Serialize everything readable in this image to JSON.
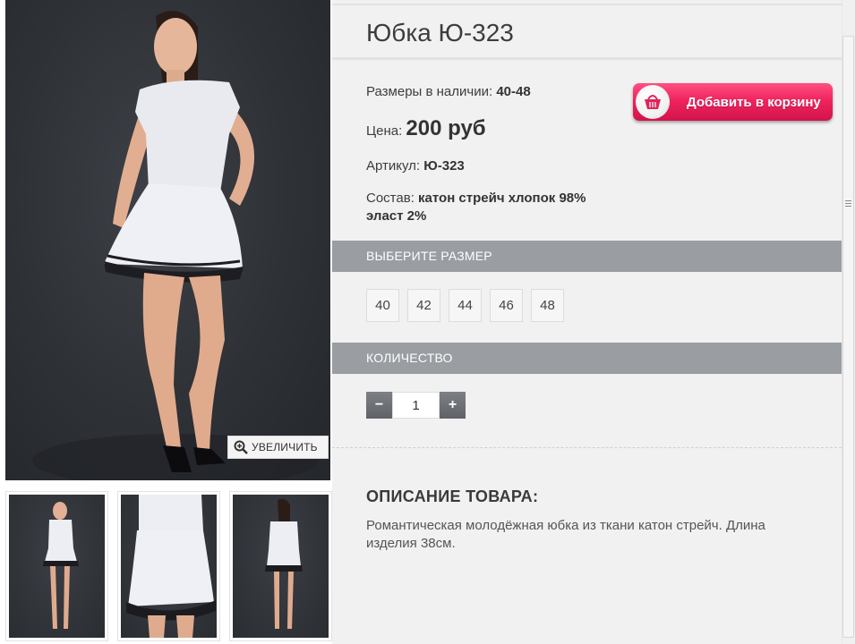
{
  "product": {
    "title": "Юбка Ю-323",
    "sizes_label": "Размеры в наличии:",
    "sizes_value": "40-48",
    "price_label": "Цена:",
    "price_value": "200 руб",
    "article_label": "Артикул:",
    "article_value": "Ю-323",
    "composition_label": "Состав:",
    "composition_value_1": "катон стрейч хлопок 98%",
    "composition_value_2": "эласт 2%"
  },
  "cart_button": {
    "label": "Добавить в корзину",
    "icon": "basket-icon",
    "color": "#ef2a60"
  },
  "size_section": {
    "title": "ВЫБЕРИТЕ РАЗМЕР",
    "options": [
      "40",
      "42",
      "44",
      "46",
      "48"
    ]
  },
  "quantity_section": {
    "title": "КОЛИЧЕСТВО",
    "value": "1",
    "minus": "−",
    "plus": "+"
  },
  "description": {
    "title": "ОПИСАНИЕ ТОВАРА:",
    "text": "Романтическая молодёжная юбка из ткани катон стрейч. Длина изделия 38см."
  },
  "gallery": {
    "zoom_label": "УВЕЛИЧИТЬ",
    "zoom_icon": "zoom-in-icon",
    "thumbnail_count": 3
  },
  "colors": {
    "section_bar": "#9a9da2",
    "panel_bg": "#f1f1f1",
    "accent": "#ef2a60"
  }
}
